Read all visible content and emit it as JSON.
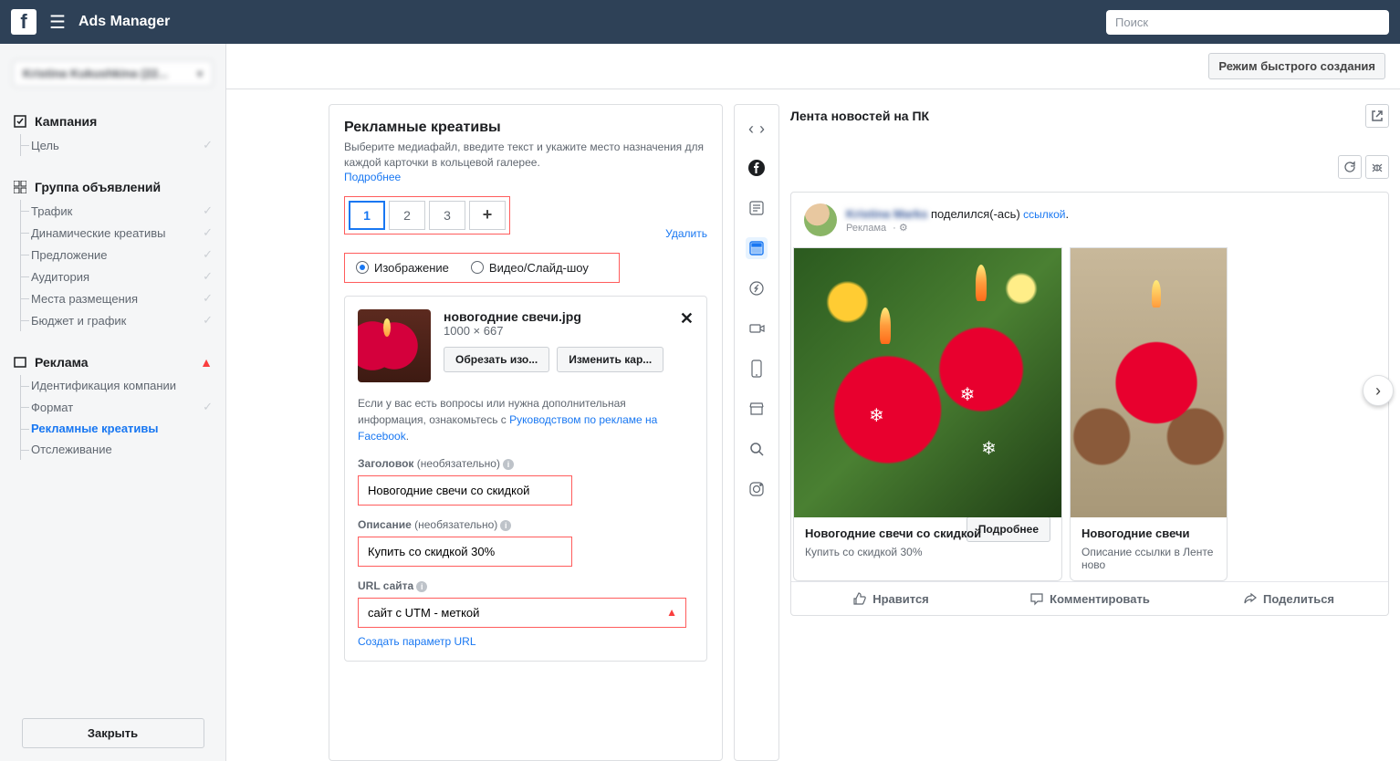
{
  "topbar": {
    "title": "Ads Manager",
    "search_placeholder": "Поиск"
  },
  "account": {
    "name": "Kristina Kukushkina (22..."
  },
  "sidebar": {
    "campaign": {
      "title": "Кампания",
      "items": [
        {
          "label": "Цель"
        }
      ]
    },
    "adset": {
      "title": "Группа объявлений",
      "items": [
        {
          "label": "Трафик"
        },
        {
          "label": "Динамические креативы"
        },
        {
          "label": "Предложение"
        },
        {
          "label": "Аудитория"
        },
        {
          "label": "Места размещения"
        },
        {
          "label": "Бюджет и график"
        }
      ]
    },
    "ad": {
      "title": "Реклама",
      "items": [
        {
          "label": "Идентификация компании"
        },
        {
          "label": "Формат"
        },
        {
          "label": "Рекламные креативы"
        },
        {
          "label": "Отслеживание"
        }
      ]
    },
    "close": "Закрыть"
  },
  "header": {
    "quick": "Режим быстрого создания"
  },
  "form": {
    "title": "Рекламные креативы",
    "subtitle": "Выберите медиафайл, введите текст и укажите место назначения для каждой карточки в кольцевой галерее.",
    "more": "Подробнее",
    "cards": [
      "1",
      "2",
      "3"
    ],
    "media": {
      "image_label": "Изображение",
      "video_label": "Видео/Слайд-шоу",
      "delete": "Удалить",
      "file_name": "новогодние свечи.jpg",
      "file_dim": "1000 × 667",
      "crop": "Обрезать изо...",
      "change": "Изменить кар...",
      "help_pre": "Если у вас есть вопросы или нужна дополнительная информация, ознакомьтесь с ",
      "help_link": "Руководством по рекламе на Facebook",
      "help_post": "."
    },
    "headline": {
      "label": "Заголовок",
      "opt": "(необязательно)",
      "value": "Новогодние свечи со скидкой"
    },
    "description": {
      "label": "Описание",
      "opt": "(необязательно)",
      "value": "Купить со скидкой 30%"
    },
    "url": {
      "label": "URL сайта",
      "value": "сайт с UTM - меткой",
      "create": "Создать параметр URL"
    }
  },
  "preview": {
    "title": "Лента новостей на ПК",
    "post": {
      "author": "Kristina Marks",
      "shared": "поделился(-ась)",
      "link_word": "ссылкой",
      "meta": "Реклама"
    },
    "cards": [
      {
        "title": "Новогодние свечи со скидкой",
        "desc": "Купить со скидкой 30%",
        "cta": "Подробнее"
      },
      {
        "title": "Новогодние свечи",
        "desc": "Описание ссылки в Ленте ново"
      }
    ],
    "actions": {
      "like": "Нравится",
      "comment": "Комментировать",
      "share": "Поделиться"
    }
  }
}
